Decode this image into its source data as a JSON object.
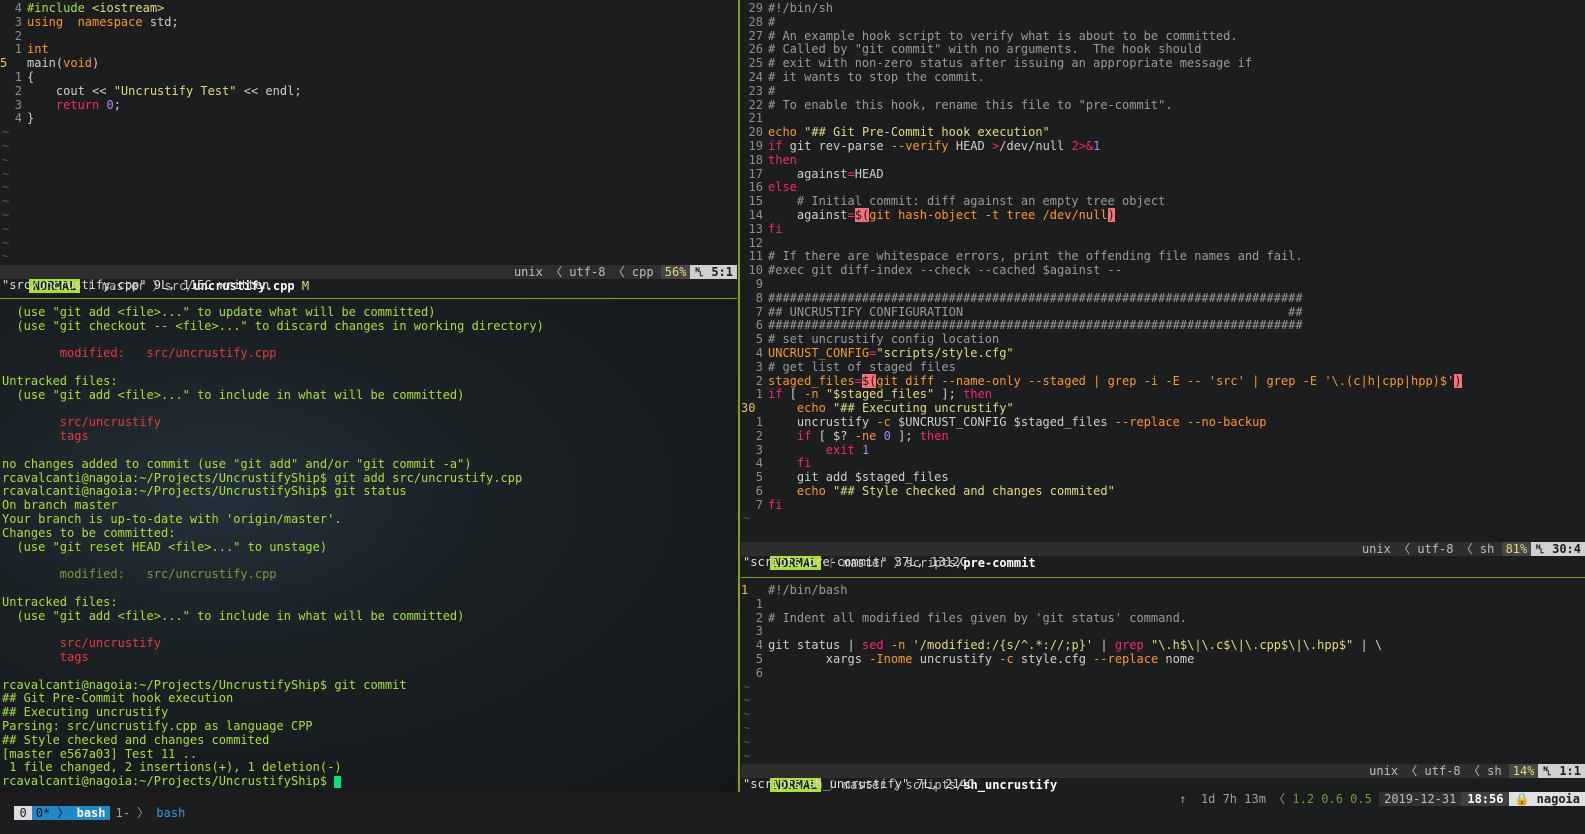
{
  "left_top": {
    "code": [
      {
        "n": "4",
        "parts": [
          [
            "c-pp",
            "#include "
          ],
          [
            "c-str",
            "<iostream>"
          ]
        ]
      },
      {
        "n": "3",
        "parts": [
          [
            "c-kw2",
            "using"
          ],
          [
            "",
            "  "
          ],
          [
            "c-kw2",
            "namespace"
          ],
          [
            "",
            " std;"
          ]
        ]
      },
      {
        "n": "2",
        "parts": []
      },
      {
        "n": "1",
        "parts": [
          [
            "c-kw2",
            "int"
          ]
        ]
      },
      {
        "n": "5",
        "cur": true,
        "parts": [
          [
            "",
            "main("
          ],
          [
            "c-kw2",
            "void"
          ],
          [
            "",
            ")"
          ]
        ]
      },
      {
        "n": "1",
        "parts": [
          [
            "",
            "{"
          ]
        ]
      },
      {
        "n": "2",
        "parts": [
          [
            "",
            "    cout << "
          ],
          [
            "c-str",
            "\"Uncrustify Test\""
          ],
          [
            "",
            " << endl;"
          ]
        ]
      },
      {
        "n": "3",
        "parts": [
          [
            "",
            "    "
          ],
          [
            "c-kw",
            "return"
          ],
          [
            "",
            " "
          ],
          [
            "c-num",
            "0"
          ],
          [
            "",
            ";"
          ]
        ]
      },
      {
        "n": "4",
        "parts": [
          [
            "",
            "}"
          ]
        ]
      }
    ],
    "tildes": 10,
    "status": {
      "mode": "NORMAL",
      "branch": "master",
      "path": "src/",
      "file": "uncrustify.cpp",
      "modified": "M",
      "format": "unix",
      "encoding": "utf-8",
      "ftype": "cpp",
      "percent": "56%",
      "pos": "5:1"
    },
    "message": "\"src/uncrustify.cpp\" 9L, 115C written"
  },
  "terminal": [
    [
      "t-grn",
      "  (use \"git add <file>...\" to update what will be committed)"
    ],
    [
      "t-grn",
      "  (use \"git checkout -- <file>...\" to discard changes in working directory)"
    ],
    [
      "",
      ""
    ],
    [
      "t-red",
      "        modified:   src/uncrustify.cpp"
    ],
    [
      "",
      ""
    ],
    [
      "t-grn",
      "Untracked files:"
    ],
    [
      "t-grn",
      "  (use \"git add <file>...\" to include in what will be committed)"
    ],
    [
      "",
      ""
    ],
    [
      "t-red",
      "        src/uncrustify"
    ],
    [
      "t-red",
      "        tags"
    ],
    [
      "",
      ""
    ],
    [
      "t-grn",
      "no changes added to commit (use \"git add\" and/or \"git commit -a\")"
    ],
    [
      "t-grn",
      "rcavalcanti@nagoia:~/Projects/UncrustifyShip$ git add src/uncrustify.cpp"
    ],
    [
      "t-grn",
      "rcavalcanti@nagoia:~/Projects/UncrustifyShip$ git status"
    ],
    [
      "t-grn",
      "On branch master"
    ],
    [
      "t-grn",
      "Your branch is up-to-date with 'origin/master'."
    ],
    [
      "t-grn",
      "Changes to be committed:"
    ],
    [
      "t-grn",
      "  (use \"git reset HEAD <file>...\" to unstage)"
    ],
    [
      "",
      ""
    ],
    [
      "t-dim",
      "        modified:   src/uncrustify.cpp"
    ],
    [
      "",
      ""
    ],
    [
      "t-grn",
      "Untracked files:"
    ],
    [
      "t-grn",
      "  (use \"git add <file>...\" to include in what will be committed)"
    ],
    [
      "",
      ""
    ],
    [
      "t-red",
      "        src/uncrustify"
    ],
    [
      "t-red",
      "        tags"
    ],
    [
      "",
      ""
    ],
    [
      "t-grn",
      "rcavalcanti@nagoia:~/Projects/UncrustifyShip$ git commit"
    ],
    [
      "t-grn",
      "## Git Pre-Commit hook execution"
    ],
    [
      "t-grn",
      "## Executing uncrustify"
    ],
    [
      "t-grn",
      "Parsing: src/uncrustify.cpp as language CPP"
    ],
    [
      "t-grn",
      "## Style checked and changes commited"
    ],
    [
      "t-grn",
      "[master e567a03] Test 11 .."
    ],
    [
      "t-grn",
      " 1 file changed, 2 insertions(+), 1 deletion(-)"
    ]
  ],
  "terminal_prompt": "rcavalcanti@nagoia:~/Projects/UncrustifyShip$ ",
  "right_top": {
    "code": [
      {
        "n": "29",
        "parts": [
          [
            "c-cmt",
            "#!/bin/sh"
          ]
        ]
      },
      {
        "n": "28",
        "parts": [
          [
            "c-cmt",
            "#"
          ]
        ]
      },
      {
        "n": "27",
        "parts": [
          [
            "c-cmt",
            "# An example hook script to verify what is about to be committed."
          ]
        ]
      },
      {
        "n": "26",
        "parts": [
          [
            "c-cmt",
            "# Called by \"git commit\" with no arguments.  The hook should"
          ]
        ]
      },
      {
        "n": "25",
        "parts": [
          [
            "c-cmt",
            "# exit with non-zero status after issuing an appropriate message if"
          ]
        ]
      },
      {
        "n": "24",
        "parts": [
          [
            "c-cmt",
            "# it wants to stop the commit."
          ]
        ]
      },
      {
        "n": "23",
        "parts": [
          [
            "c-cmt",
            "#"
          ]
        ]
      },
      {
        "n": "22",
        "parts": [
          [
            "c-cmt",
            "# To enable this hook, rename this file to \"pre-commit\"."
          ]
        ]
      },
      {
        "n": "21",
        "parts": []
      },
      {
        "n": "20",
        "parts": [
          [
            "c-kw2",
            "echo"
          ],
          [
            "",
            " "
          ],
          [
            "c-str",
            "\"## Git Pre-Commit hook execution\""
          ]
        ]
      },
      {
        "n": "19",
        "parts": [
          [
            "c-kw",
            "if"
          ],
          [
            "",
            " git rev-parse "
          ],
          [
            "c-opt",
            "--verify"
          ],
          [
            "",
            " HEAD "
          ],
          [
            "c-kw",
            ">"
          ],
          [
            "",
            "/dev/null "
          ],
          [
            "c-kw",
            "2>&"
          ],
          [
            "c-num",
            "1"
          ]
        ]
      },
      {
        "n": "18",
        "parts": [
          [
            "c-kw",
            "then"
          ]
        ]
      },
      {
        "n": "17",
        "parts": [
          [
            "",
            "    against"
          ],
          [
            "c-kw",
            "="
          ],
          [
            "",
            "HEAD"
          ]
        ]
      },
      {
        "n": "16",
        "parts": [
          [
            "c-kw",
            "else"
          ]
        ]
      },
      {
        "n": "15",
        "parts": [
          [
            "c-cmt",
            "    # Initial commit: diff against an empty tree object"
          ]
        ]
      },
      {
        "n": "14",
        "parts": [
          [
            "",
            "    against"
          ],
          [
            "c-kw",
            "="
          ],
          [
            "c-hl",
            "$("
          ],
          [
            "c-kw2",
            "git hash-object -t tree /dev/null"
          ],
          [
            "c-hl",
            ")"
          ]
        ]
      },
      {
        "n": "13",
        "parts": [
          [
            "c-kw",
            "fi"
          ]
        ]
      },
      {
        "n": "12",
        "parts": []
      },
      {
        "n": "11",
        "parts": [
          [
            "c-cmt",
            "# If there are whitespace errors, print the offending file names and fail."
          ]
        ]
      },
      {
        "n": "10",
        "parts": [
          [
            "c-cmt",
            "#exec git diff-index --check --cached $against --"
          ]
        ]
      },
      {
        "n": "9",
        "parts": []
      },
      {
        "n": "8",
        "parts": [
          [
            "c-cmt",
            "##########################################################################"
          ]
        ]
      },
      {
        "n": "7",
        "parts": [
          [
            "c-cmt",
            "## UNCRUSTIFY CONFIGURATION                                             ##"
          ]
        ]
      },
      {
        "n": "6",
        "parts": [
          [
            "c-cmt",
            "##########################################################################"
          ]
        ]
      },
      {
        "n": "5",
        "parts": [
          [
            "c-cmt",
            "# set uncrustify config location"
          ]
        ]
      },
      {
        "n": "4",
        "parts": [
          [
            "c-kw2",
            "UNCRUST_CONFIG"
          ],
          [
            "c-kw",
            "="
          ],
          [
            "c-str",
            "\"scripts/style.cfg\""
          ]
        ]
      },
      {
        "n": "3",
        "parts": [
          [
            "c-cmt",
            "# get list of staged files"
          ]
        ]
      },
      {
        "n": "2",
        "parts": [
          [
            "c-kw2",
            "staged_files"
          ],
          [
            "c-kw",
            "="
          ],
          [
            "c-hl",
            "$("
          ],
          [
            "c-kw2",
            "git diff --name-only --staged | grep -i -E -- 'src' | grep -E '\\.(c|h|cpp|hpp)$'"
          ],
          [
            "c-hl",
            ")"
          ]
        ]
      },
      {
        "n": "1",
        "parts": [
          [
            "c-kw",
            "if"
          ],
          [
            "",
            " [ "
          ],
          [
            "c-opt",
            "-n"
          ],
          [
            "",
            " "
          ],
          [
            "c-str",
            "\"$staged_files\""
          ],
          [
            "",
            " ]; "
          ],
          [
            "c-kw",
            "then"
          ]
        ]
      },
      {
        "n": "30",
        "cur": true,
        "parts": [
          [
            "",
            "    "
          ],
          [
            "c-kw2",
            "echo"
          ],
          [
            "",
            " "
          ],
          [
            "c-str",
            "\"## Executing uncrustify\""
          ]
        ]
      },
      {
        "n": "1",
        "parts": [
          [
            "",
            "    uncrustify "
          ],
          [
            "c-opt",
            "-c"
          ],
          [
            "",
            " $UNCRUST_CONFIG $staged_files "
          ],
          [
            "c-opt",
            "--replace --no-backup"
          ]
        ]
      },
      {
        "n": "2",
        "parts": [
          [
            "",
            "    "
          ],
          [
            "c-kw",
            "if"
          ],
          [
            "",
            " [ $? "
          ],
          [
            "c-opt",
            "-ne"
          ],
          [
            "",
            " "
          ],
          [
            "c-num",
            "0"
          ],
          [
            "",
            " ]; "
          ],
          [
            "c-kw",
            "then"
          ]
        ]
      },
      {
        "n": "3",
        "parts": [
          [
            "",
            "        "
          ],
          [
            "c-kw",
            "exit"
          ],
          [
            "",
            " "
          ],
          [
            "c-num",
            "1"
          ]
        ]
      },
      {
        "n": "4",
        "parts": [
          [
            "",
            "    "
          ],
          [
            "c-kw",
            "fi"
          ]
        ]
      },
      {
        "n": "5",
        "parts": [
          [
            "",
            "    git add $staged_files"
          ]
        ]
      },
      {
        "n": "6",
        "parts": [
          [
            "",
            "    "
          ],
          [
            "c-kw2",
            "echo"
          ],
          [
            "",
            " "
          ],
          [
            "c-str",
            "\"## Style checked and changes commited\""
          ]
        ]
      },
      {
        "n": "7",
        "parts": [
          [
            "c-kw",
            "fi"
          ]
        ]
      }
    ],
    "tildes": 1,
    "status": {
      "mode": "NORMAL",
      "branch": "master",
      "path": "scripts/",
      "file": "pre-commit",
      "format": "unix",
      "encoding": "utf-8",
      "ftype": "sh",
      "percent": "81%",
      "pos": "30:4"
    },
    "message": "\"scripts/pre-commit\" 37L, 1312C"
  },
  "right_bottom": {
    "code": [
      {
        "n": "1",
        "cur": true,
        "parts": [
          [
            "c-cmt",
            "#!/bin/bash"
          ]
        ]
      },
      {
        "n": "1",
        "parts": []
      },
      {
        "n": "2",
        "parts": [
          [
            "c-cmt",
            "# Indent all modified files given by 'git status' command."
          ]
        ]
      },
      {
        "n": "3",
        "parts": []
      },
      {
        "n": "4",
        "parts": [
          [
            "",
            "git status | "
          ],
          [
            "c-kw",
            "sed"
          ],
          [
            "",
            " "
          ],
          [
            "c-opt",
            "-n"
          ],
          [
            "",
            " "
          ],
          [
            "c-str",
            "'/modified:/{s/^.*://;p}'"
          ],
          [
            "",
            " | "
          ],
          [
            "c-kw",
            "grep"
          ],
          [
            "",
            " "
          ],
          [
            "c-str",
            "\"\\.h$\\|\\.c$\\|\\.cpp$\\|\\.hpp$\""
          ],
          [
            "",
            " | \\"
          ]
        ]
      },
      {
        "n": "5",
        "parts": [
          [
            "",
            "        xargs "
          ],
          [
            "c-opt",
            "-Inome"
          ],
          [
            "",
            " uncrustify "
          ],
          [
            "c-opt",
            "-c"
          ],
          [
            "",
            " style.cfg "
          ],
          [
            "c-opt",
            "--replace"
          ],
          [
            "",
            " nome"
          ]
        ]
      },
      {
        "n": "6",
        "parts": []
      }
    ],
    "tildes": 6,
    "status": {
      "mode": "NORMAL",
      "branch": "master",
      "path": "scripts/",
      "file": "sh_uncrustify",
      "format": "unix",
      "encoding": "utf-8",
      "ftype": "sh",
      "percent": "14%",
      "pos": "1:1"
    },
    "message": "\"scripts/sh_uncrustify\" 7L, 214C"
  },
  "tmux": {
    "session": "0",
    "win0_index": "0*",
    "win0_name": "bash",
    "win1_index": "1-",
    "win1_name": "bash",
    "uptime": "1d 7h 13m",
    "load": "1.2 0.6 0.5",
    "date": "2019-12-31",
    "time": "18:56",
    "host": "nagoia"
  },
  "colors": {
    "accent": "#a6e22e",
    "divider": "#7fa21a",
    "window_active": "#1e88c8"
  }
}
